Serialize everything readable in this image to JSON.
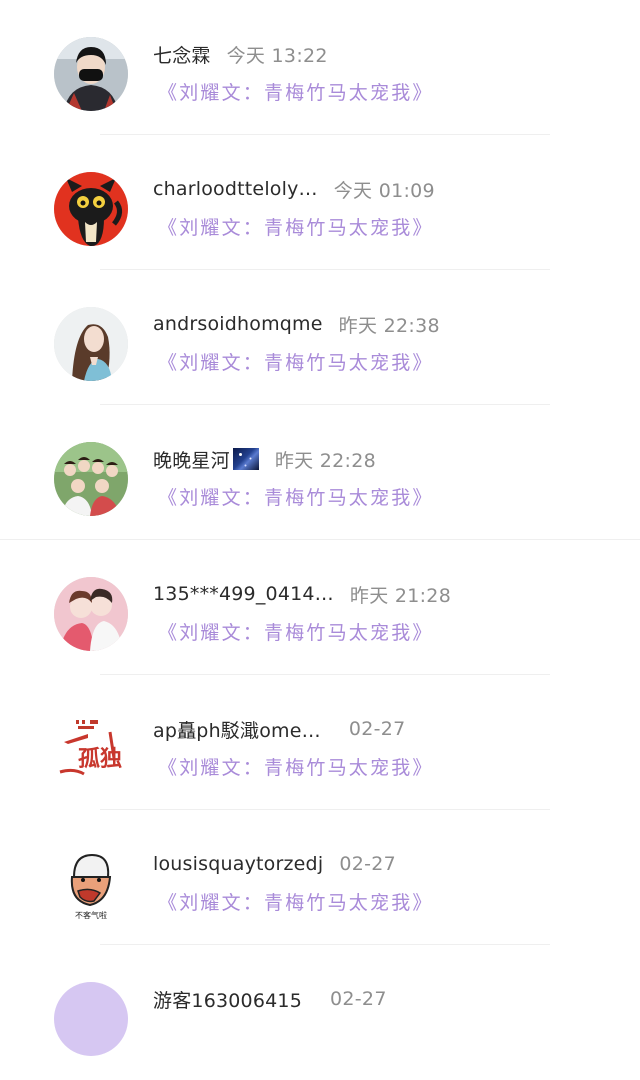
{
  "messages": [
    {
      "name": "七念霖",
      "time": "今天 13:22",
      "book": "《刘耀文：青梅竹马太宠我》",
      "avatar_icon": "user-avatar-black-mask"
    },
    {
      "name": "charloodtteloly…",
      "time": "今天 01:09",
      "book": "《刘耀文：青梅竹马太宠我》",
      "avatar_icon": "cartoon-cat-avatar"
    },
    {
      "name": "andrsoidhomqme",
      "time": "昨天 22:38",
      "book": "《刘耀文：青梅竹马太宠我》",
      "avatar_icon": "girl-photo-avatar"
    },
    {
      "name": "晚晚星河",
      "time": "昨天 22:28",
      "book": "《刘耀文：青梅竹马太宠我》",
      "avatar_icon": "group-photo-avatar"
    },
    {
      "name": "135***499_0414…",
      "time": "昨天 21:28",
      "book": "《刘耀文：青梅竹马太宠我》",
      "avatar_icon": "pink-photo-avatar"
    },
    {
      "name": "ap矗ph駁濈ome…",
      "time": "02-27",
      "book": "《刘耀文：青梅竹马太宠我》",
      "avatar_icon": "red-calligraphy-avatar",
      "avatar_text": "孤独"
    },
    {
      "name": "lousisquaytorzedj",
      "time": "02-27",
      "book": "《刘耀文：青梅竹马太宠我》",
      "avatar_icon": "cartoon-face-avatar",
      "avatar_caption": "不客气啦"
    },
    {
      "name": "游客163006415",
      "time": "02-27",
      "book": "",
      "avatar_icon": "default-purple-avatar"
    }
  ],
  "colors": {
    "name": "#2b2b2b",
    "time": "#8e8e8e",
    "book_link": "#a98bd9",
    "divider": "#efefef"
  }
}
